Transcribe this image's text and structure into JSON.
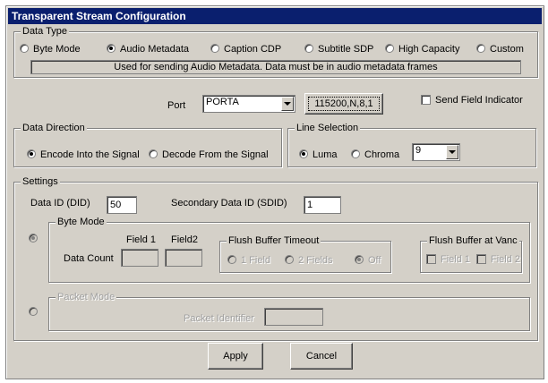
{
  "window": {
    "title": "Transparent Stream Configuration"
  },
  "data_type": {
    "label": "Data Type",
    "options": [
      {
        "label": "Byte Mode",
        "selected": false
      },
      {
        "label": "Audio Metadata",
        "selected": true
      },
      {
        "label": "Caption CDP",
        "selected": false
      },
      {
        "label": "Subtitle SDP",
        "selected": false
      },
      {
        "label": "High Capacity",
        "selected": false
      },
      {
        "label": "Custom",
        "selected": false
      }
    ],
    "description": "Used for sending Audio Metadata. Data must be in audio metadata frames"
  },
  "port": {
    "label": "Port",
    "selected": "PORTA",
    "settings_button": "115200,N,8,1",
    "send_field_indicator_label": "Send Field Indicator",
    "send_field_indicator_checked": false
  },
  "data_direction": {
    "label": "Data Direction",
    "options": [
      {
        "label": "Encode Into the Signal",
        "selected": true
      },
      {
        "label": "Decode From the Signal",
        "selected": false
      }
    ]
  },
  "line_selection": {
    "label": "Line Selection",
    "options": [
      {
        "label": "Luma",
        "selected": true
      },
      {
        "label": "Chroma",
        "selected": false
      }
    ],
    "line_value": "9"
  },
  "settings": {
    "label": "Settings",
    "did_label": "Data ID (DID)",
    "did_value": "50",
    "sdid_label": "Secondary Data ID (SDID)",
    "sdid_value": "1",
    "byte_mode": {
      "label": "Byte Mode",
      "field1_header": "Field 1",
      "field2_header": "Field2",
      "data_count_label": "Data Count",
      "field1_value": "",
      "field2_value": "",
      "flush_timeout": {
        "label": "Flush Buffer Timeout",
        "options": [
          {
            "label": "1 Field",
            "selected": false
          },
          {
            "label": "2 Fields",
            "selected": false
          },
          {
            "label": "Off",
            "selected": true
          }
        ]
      },
      "flush_vanc": {
        "label": "Flush Buffer at Vanc",
        "options": [
          {
            "label": "Field 1",
            "checked": false
          },
          {
            "label": "Field 2",
            "checked": false
          }
        ]
      }
    },
    "packet_mode": {
      "label": "Packet Mode",
      "identifier_label": "Packet Identifier",
      "identifier_value": ""
    }
  },
  "buttons": {
    "apply": "Apply",
    "cancel": "Cancel"
  },
  "icons": {
    "dropdown": "chevron-down-icon"
  }
}
